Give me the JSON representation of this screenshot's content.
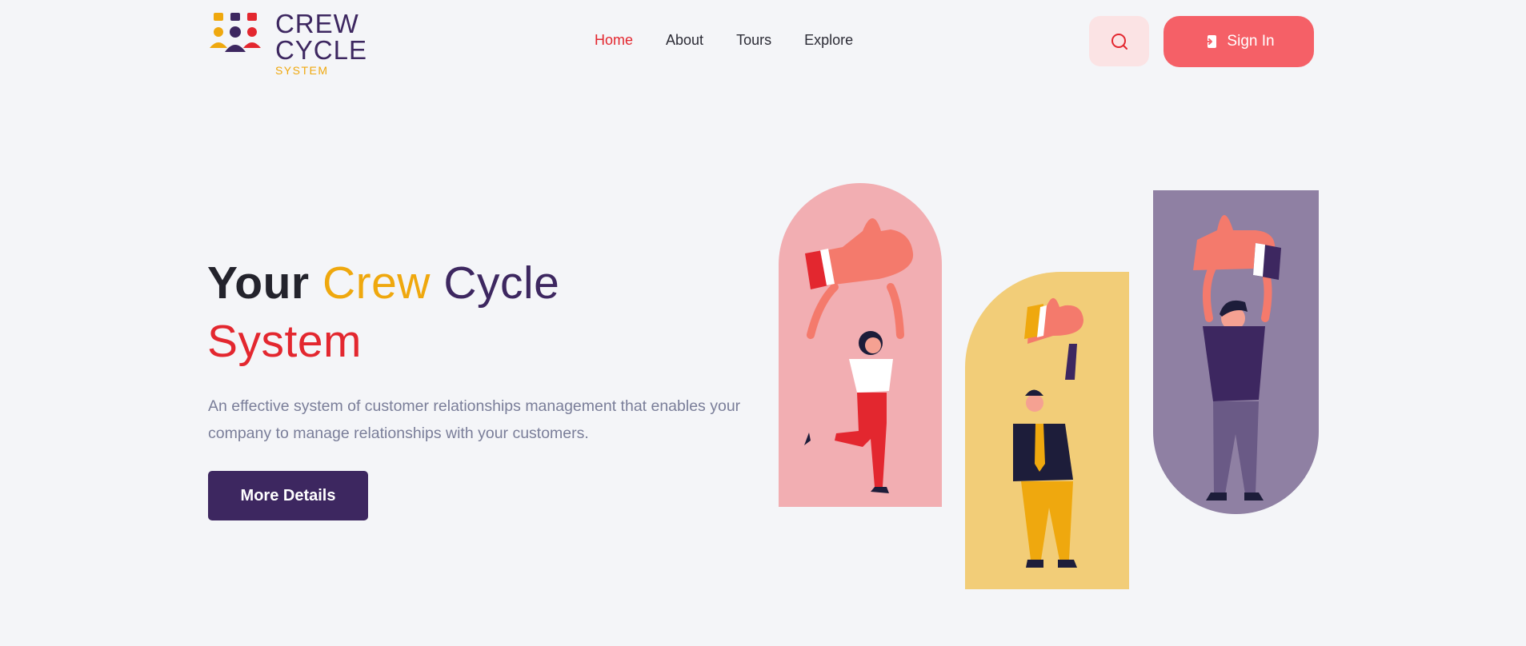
{
  "logo": {
    "line1": "CREW",
    "line2": "CYCLE",
    "line3": "SYSTEM"
  },
  "nav": {
    "items": [
      "Home",
      "About",
      "Tours",
      "Explore"
    ],
    "active": "Home"
  },
  "header": {
    "signin_label": "Sign In"
  },
  "hero": {
    "title_word1": "Your",
    "title_word2": "Crew",
    "title_word3": "Cycle",
    "title_word4": "System",
    "description": "An effective system of customer relationships management that enables your company to manage relationships with your customers.",
    "button_label": "More Details"
  },
  "colors": {
    "accent_red": "#e3272f",
    "accent_yellow": "#efa80e",
    "brand_purple": "#3d2760",
    "signin_bg": "#f56067",
    "search_bg": "#fbe3e4"
  },
  "icons": [
    "logo-people-icon",
    "search-icon",
    "sign-in-icon"
  ]
}
